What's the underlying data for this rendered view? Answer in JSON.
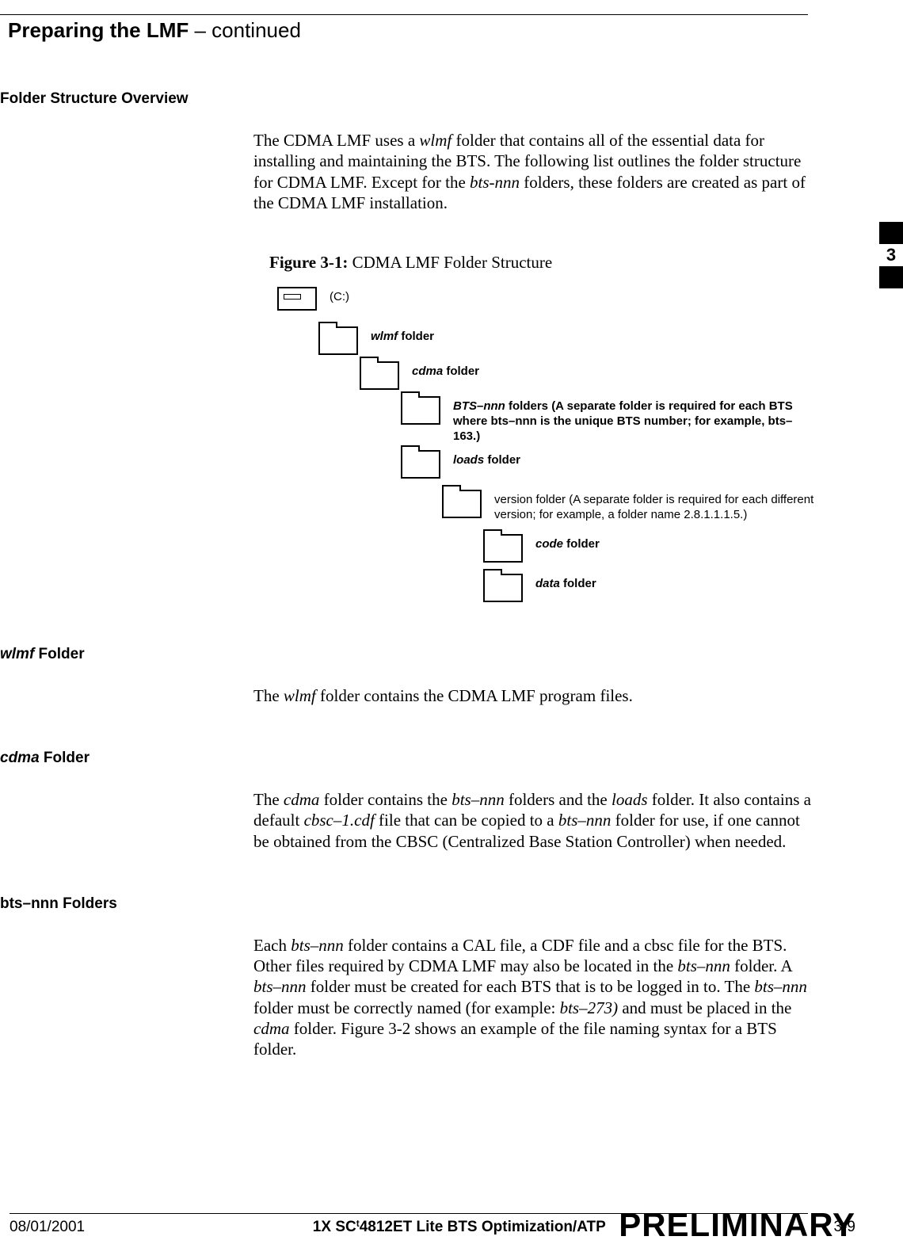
{
  "header": {
    "title": "Preparing the LMF",
    "suffix": " – continued"
  },
  "section1": {
    "heading": "Folder Structure Overview",
    "para_part1": "The CDMA LMF uses a ",
    "para_ital1": "wlmf",
    "para_part2": " folder that contains all of the essential data for installing and maintaining the BTS. The following list outlines the folder structure for CDMA LMF. Except for the ",
    "para_ital2": "bts-nnn",
    "para_part3": " folders, these folders are created as part of the CDMA LMF installation."
  },
  "figure": {
    "label": "Figure 3-1:",
    "caption": " CDMA LMF Folder Structure",
    "nodes": {
      "drive": "(C:)",
      "wlmf_ital": "wlmf",
      "wlmf_rest": " folder",
      "cdma_ital": "cdma",
      "cdma_rest": " folder",
      "bts_ital": "BTS–nnn",
      "bts_rest": " folders (A separate folder is required for each BTS where bts–nnn is the unique BTS number; for example, bts–163.)",
      "loads_ital": "loads",
      "loads_rest": " folder",
      "version": "version folder (A separate folder is required for each different version; for example, a folder name 2.8.1.1.1.5.)",
      "code_ital": "code",
      "code_rest": " folder",
      "data_ital": "data",
      "data_rest": " folder"
    }
  },
  "tab": {
    "number": "3"
  },
  "wlmf_section": {
    "heading_ital": "wlmf",
    "heading_rest": " Folder",
    "para_p1": "The ",
    "para_i1": "wlmf",
    "para_p2": " folder contains the CDMA LMF program files."
  },
  "cdma_section": {
    "heading_ital": "cdma",
    "heading_rest": " Folder",
    "para_p1": "The ",
    "para_i1": "cdma",
    "para_p2": " folder contains the ",
    "para_i2": "bts–nnn",
    "para_p3": " folders and the ",
    "para_i3": "loads",
    "para_p4": " folder. It also contains a default ",
    "para_i4": "cbsc–1.cdf",
    "para_p5": " file that can be copied to a ",
    "para_i5": "bts–nnn",
    "para_p6": " folder for use, if one cannot be obtained from the CBSC (Centralized Base Station Controller) when needed."
  },
  "bts_section": {
    "heading": "bts–nnn Folders",
    "para_p1": "Each ",
    "para_i1": "bts–nnn",
    "para_p2": " folder contains a CAL file, a CDF file and a cbsc file for the BTS. Other files required by CDMA LMF may also be located in the ",
    "para_i2": "bts–nnn",
    "para_p3": " folder. A ",
    "para_i3": "bts–nnn",
    "para_p4": " folder must be created for each BTS that is to be logged in to. The ",
    "para_i4": "bts–nnn",
    "para_p5": " folder must be correctly named (for example: ",
    "para_i5": "bts–273)",
    "para_p6": " and must be placed in the ",
    "para_i6": "cdma",
    "para_p7": " folder. Figure 3-2 shows an example of the file naming syntax for a BTS folder."
  },
  "footer": {
    "date": "08/01/2001",
    "center_p1": "1X SC",
    "center_tm": "t",
    "center_p2": "4812ET Lite BTS Optimization/ATP",
    "page": "3-9",
    "watermark": "PRELIMINARY"
  }
}
